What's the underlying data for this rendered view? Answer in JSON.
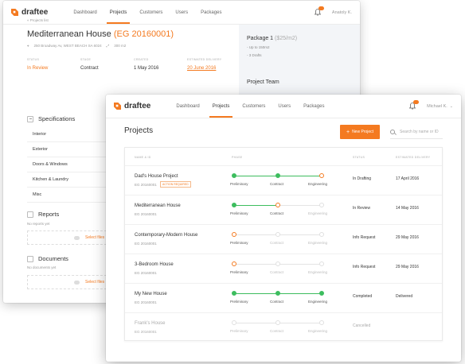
{
  "colors": {
    "accent": "#f47a20",
    "success": "#3dbd5e"
  },
  "brand": {
    "name": "draftee"
  },
  "back": {
    "nav": {
      "items": [
        "Dashboard",
        "Projects",
        "Customers",
        "Users",
        "Packages"
      ],
      "active": 1,
      "user": "Anatoly K."
    },
    "breadcrumb": "« Projects list",
    "title": "Mediterranean House",
    "code": "(EG 20160001)",
    "address": "250 Broadway Av, WEST BEACH SA 6024",
    "area": "300 m2",
    "meta": [
      {
        "label": "STATUS",
        "value": "In Review",
        "style": "or"
      },
      {
        "label": "STAGE",
        "value": "Contract",
        "style": ""
      },
      {
        "label": "CREATED",
        "value": "1 May 2016",
        "style": ""
      },
      {
        "label": "ESTIMATED DELIVERY",
        "value": "20 June 2016",
        "style": "link"
      }
    ],
    "specifications": {
      "title": "Specifications",
      "items": [
        "Interior",
        "Exterior",
        "Doors & Windows",
        "Kitchen & Laundry",
        "Misc"
      ]
    },
    "reports": {
      "title": "Reports",
      "empty": "No reports yet",
      "upload": "Select files"
    },
    "documents": {
      "title": "Documents",
      "empty": "No documents yet",
      "upload": "Select files"
    },
    "package": {
      "title": "Package 1",
      "price": "($25/m2)",
      "lines": [
        "- Up to 150m2",
        "- 3 Drafts"
      ]
    },
    "team": "Project Team"
  },
  "front": {
    "nav": {
      "items": [
        "Dashboard",
        "Projects",
        "Customers",
        "Users",
        "Packages"
      ],
      "active": 1,
      "user": "Michael K."
    },
    "heading": "Projects",
    "new_button": "New Project",
    "search_placeholder": "Search by name or ID",
    "columns": {
      "name": "NAME & ID",
      "phase": "PHASE",
      "status": "STATUS",
      "delivery": "ESTIMATED DELIVERY"
    },
    "phase_labels": [
      "Preliminary",
      "Contract",
      "Engineering"
    ],
    "rows": [
      {
        "name": "Dad's House Project",
        "id": "EG 20160001",
        "badge": "ACTION REQUIRED",
        "phase": [
          "done",
          "done",
          "cur"
        ],
        "fill": 1.0,
        "status": "In Drafting",
        "delivery": "17 April 2016",
        "muted": false
      },
      {
        "name": "Mediterranean House",
        "id": "EG 20160001",
        "badge": "",
        "phase": [
          "done",
          "cur",
          "todo"
        ],
        "fill": 0.5,
        "status": "In Review",
        "delivery": "14 May 2016",
        "muted": false
      },
      {
        "name": "Contemporary-Modern House",
        "id": "EG 20160001",
        "badge": "",
        "phase": [
          "cur",
          "todo",
          "todo"
        ],
        "fill": 0,
        "status": "Info Request",
        "delivery": "29 May 2016",
        "muted": false
      },
      {
        "name": "3-Bedroom House",
        "id": "EG 20160001",
        "badge": "",
        "phase": [
          "cur",
          "todo",
          "todo"
        ],
        "fill": 0,
        "status": "Info Request",
        "delivery": "29 May 2016",
        "muted": false
      },
      {
        "name": "My New House",
        "id": "EG 20160001",
        "badge": "",
        "phase": [
          "done",
          "done",
          "done"
        ],
        "fill": 1.0,
        "status": "Completed",
        "delivery": "Delivered",
        "muted": false
      },
      {
        "name": "Frank's House",
        "id": "EG 20160001",
        "badge": "",
        "phase": [
          "todo",
          "todo",
          "todo"
        ],
        "fill": 0,
        "status": "Cancelled",
        "delivery": "",
        "muted": true
      }
    ]
  }
}
